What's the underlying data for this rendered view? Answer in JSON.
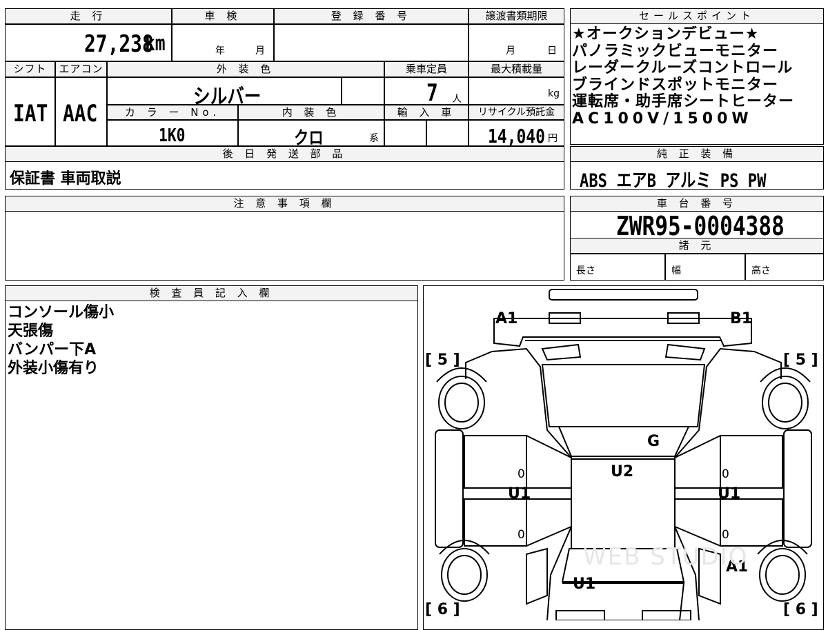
{
  "top": {
    "mileage_label": "走 行",
    "mileage_value": "27,238",
    "mileage_unit": "km",
    "shaken_label": "車 検",
    "shaken_year": "年",
    "shaken_month": "月",
    "registration_label": "登 録 番 号",
    "transfer_deadline_label": "譲渡書類期限",
    "transfer_month": "月",
    "transfer_day": "日",
    "shift_label": "シフト",
    "shift_value": "IAT",
    "aircon_label": "エアコン",
    "aircon_value": "AAC",
    "exterior_color_label": "外 装 色",
    "exterior_color_value": "シルバー",
    "capacity_label": "乗車定員",
    "capacity_value": "7",
    "capacity_unit": "人",
    "max_load_label": "最大積載量",
    "max_load_unit": "kg",
    "color_no_label": "カ ラ ー No.",
    "color_no_value": "1K0",
    "interior_color_label": "内 装 色",
    "interior_color_value": "クロ",
    "interior_color_suffix": "系",
    "import_label": "輸 入 車",
    "recycle_label": "リサイクル預託金",
    "recycle_value": "14,040",
    "recycle_unit": "円",
    "later_parts_label": "後 日 発 送 部 品",
    "later_parts_value": "保証書 車両取説",
    "notes_label": "注 意 事 項 欄"
  },
  "sales_points": {
    "label": "セールスポイント",
    "lines": [
      "★オークションデビュー★",
      "パノラミックビューモニター",
      "レーダークルーズコントロール",
      "ブラインドスポットモニター",
      "運転席・助手席シートヒーター",
      "AC100V/1500W"
    ]
  },
  "equipment": {
    "label": "純 正 装 備",
    "value": "ABS エアB アルミ PS PW"
  },
  "chassis": {
    "label": "車 台 番 号",
    "value": "ZWR95-0004388"
  },
  "specs": {
    "label": "諸 元",
    "length": "長さ",
    "width": "幅",
    "height": "高さ"
  },
  "inspector": {
    "label": "検 査 員 記 入 欄",
    "lines": [
      "コンソール傷小",
      "天張傷",
      "バンパー下A",
      "外装小傷有り"
    ]
  },
  "diagram": {
    "marks": {
      "a1_front": "A1",
      "b1_front": "B1",
      "five_left": "[ 5 ]",
      "five_right": "[ 5 ]",
      "g": "G",
      "u2": "U2",
      "u1_left": "U1",
      "u1_right": "U1",
      "zero_left_top": "0",
      "zero_left_bottom": "0",
      "zero_right_top": "0",
      "zero_right_bottom": "0",
      "a1_rear": "A1",
      "u1_rear": "U1",
      "six_left": "[ 6 ]",
      "six_right": "[ 6 ]"
    },
    "watermark": "WEB STUDIO"
  }
}
